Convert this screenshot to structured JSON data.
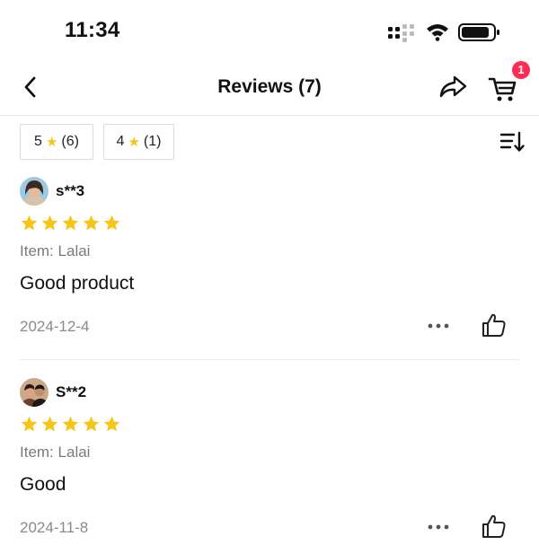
{
  "status_bar": {
    "time": "11:34"
  },
  "nav": {
    "title": "Reviews (7)",
    "cart_count": "1"
  },
  "filters": [
    {
      "rating": "5",
      "count": "(6)"
    },
    {
      "rating": "4",
      "count": "(1)"
    }
  ],
  "colors": {
    "star": "#f5c518",
    "badge": "#fe2c55",
    "muted_text": "#7a7a7a"
  },
  "reviews": [
    {
      "name": "s**3",
      "rating": 5,
      "item_label": "Item:",
      "item_value": "Lalai",
      "text": "Good product",
      "date": "2024-12-4"
    },
    {
      "name": "S**2",
      "rating": 5,
      "item_label": "Item:",
      "item_value": "Lalai",
      "text": "Good",
      "date": "2024-11-8"
    }
  ],
  "icons": [
    "signal-icon",
    "wifi-icon",
    "battery-icon",
    "back-arrow-icon",
    "share-icon",
    "cart-icon",
    "sort-icon",
    "star-icon",
    "more-dots-icon",
    "thumbs-up-icon"
  ]
}
